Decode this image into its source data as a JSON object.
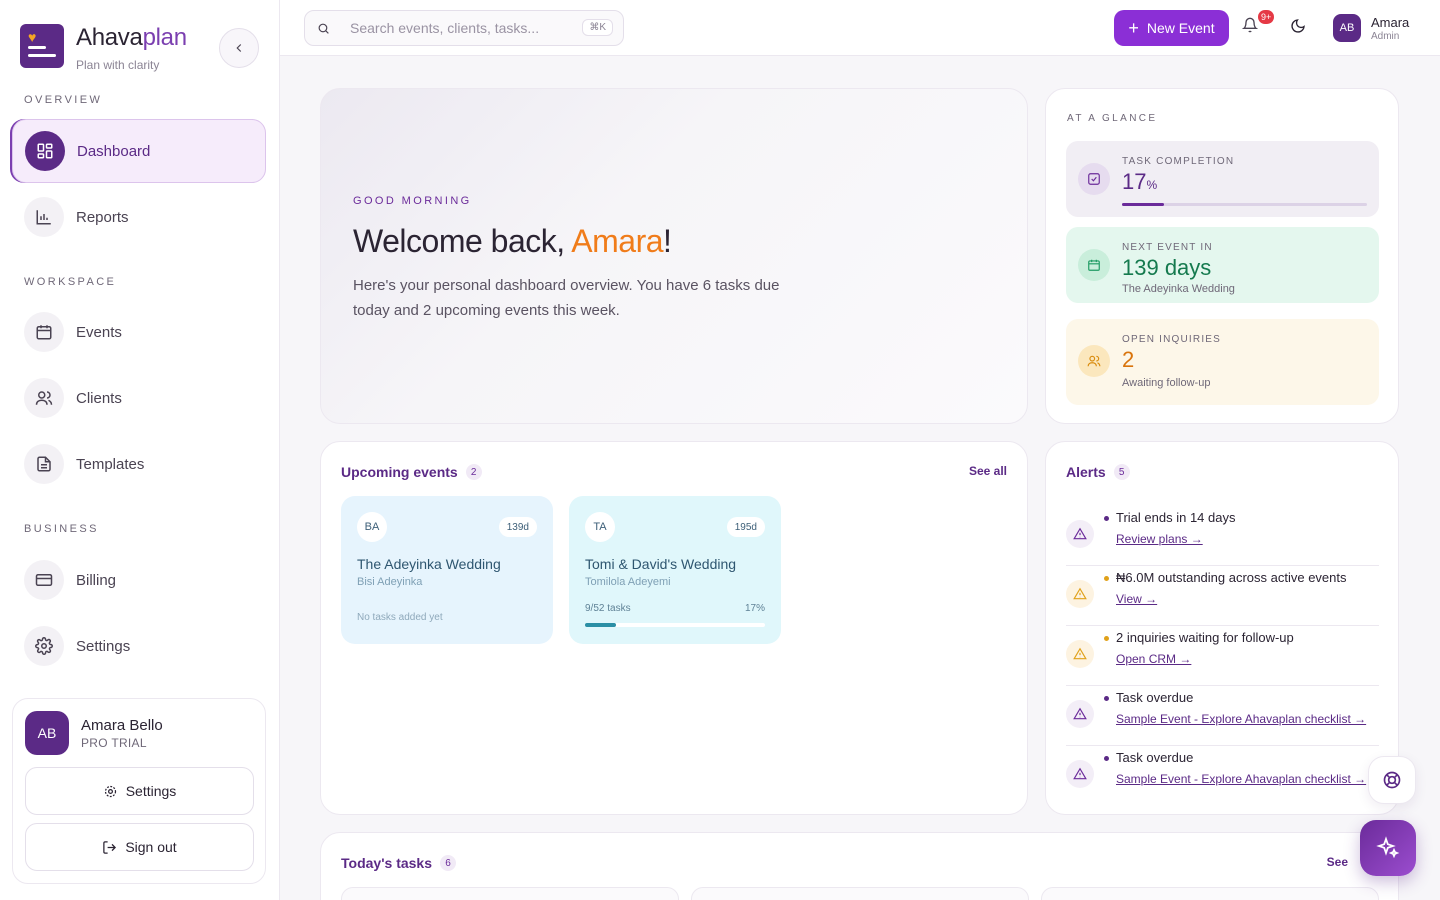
{
  "brand": {
    "name_main": "Ahava",
    "name_accent": "plan",
    "tagline": "Plan with clarity"
  },
  "sidebar": {
    "sections": [
      {
        "label": "OVERVIEW"
      },
      {
        "label": "WORKSPACE"
      },
      {
        "label": "BUSINESS"
      }
    ],
    "items": [
      {
        "label": "Dashboard",
        "icon": "dashboard-icon",
        "active": true
      },
      {
        "label": "Reports",
        "icon": "bar-chart-icon"
      },
      {
        "label": "Events",
        "icon": "calendar-icon"
      },
      {
        "label": "Clients",
        "icon": "users-icon"
      },
      {
        "label": "Templates",
        "icon": "document-icon"
      },
      {
        "label": "Billing",
        "icon": "credit-card-icon"
      },
      {
        "label": "Settings",
        "icon": "gear-icon"
      }
    ],
    "user": {
      "initials": "AB",
      "name": "Amara Bello",
      "plan": "PRO TRIAL",
      "settings_label": "Settings",
      "signout_label": "Sign out"
    }
  },
  "topbar": {
    "search_placeholder": "Search events, clients, tasks...",
    "search_shortcut": "⌘K",
    "new_event_label": "New Event",
    "notification_badge": "9+",
    "user": {
      "initials": "AB",
      "name": "Amara",
      "role": "Admin"
    }
  },
  "hero": {
    "eyebrow": "GOOD MORNING",
    "greeting": "Welcome back, ",
    "name": "Amara",
    "exclaim": "!",
    "description": "Here's your personal dashboard overview. You have 6 tasks due today and 2 upcoming events this week."
  },
  "glance": {
    "title": "AT A GLANCE",
    "task_completion": {
      "label": "TASK COMPLETION",
      "value": "17",
      "unit": "%",
      "progress": 0.17
    },
    "next_event": {
      "label": "NEXT EVENT IN",
      "value": "139 days",
      "sub": "The Adeyinka Wedding"
    },
    "inquiries": {
      "label": "OPEN INQUIRIES",
      "value": "2",
      "sub": "Awaiting follow-up"
    }
  },
  "upcoming": {
    "title": "Upcoming events",
    "count": "2",
    "see_all": "See all",
    "events": [
      {
        "initials": "BA",
        "days": "139d",
        "title": "The Adeyinka Wedding",
        "client": "Bisi Adeyinka",
        "note": "No tasks added yet"
      },
      {
        "initials": "TA",
        "days": "195d",
        "title": "Tomi & David's Wedding",
        "client": "Tomilola Adeyemi",
        "tasks": "9/52 tasks",
        "pct": "17%",
        "progress": 0.17
      }
    ]
  },
  "alerts": {
    "title": "Alerts",
    "count": "5",
    "items": [
      {
        "text": "Trial ends in 14 days",
        "link": "Review plans →",
        "tone": "purple"
      },
      {
        "text": "₦6.0M outstanding across active events",
        "link": "View →",
        "tone": "amber"
      },
      {
        "text": "2 inquiries waiting for follow-up",
        "link": "Open CRM →",
        "tone": "amber"
      },
      {
        "text": "Task overdue",
        "link": "Sample Event - Explore Ahavaplan checklist →",
        "tone": "purple"
      },
      {
        "text": "Task overdue",
        "link": "Sample Event - Explore Ahavaplan checklist →",
        "tone": "purple"
      }
    ]
  },
  "tasks": {
    "title": "Today's tasks",
    "count": "6",
    "see_all": "See"
  },
  "colors": {
    "brand": "#5b2a86",
    "primary_button": "#8b2fd6",
    "accent": "#f07c1a",
    "success": "#157a4e",
    "warning": "#d9740c"
  }
}
